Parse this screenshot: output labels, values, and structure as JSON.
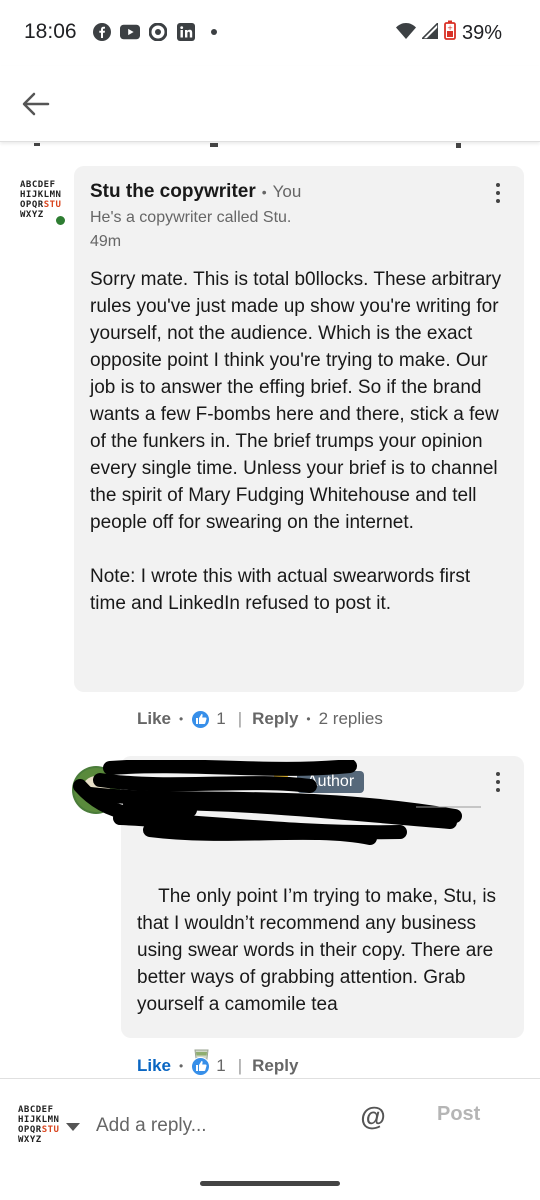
{
  "status_bar": {
    "time": "18:06",
    "left_icons": [
      "facebook-icon",
      "youtube-icon",
      "chrome-icon",
      "linkedin-icon",
      "more-notifications-dot"
    ],
    "battery_percent": "39%"
  },
  "header": {
    "back_icon": "back-arrow-icon"
  },
  "comments": [
    {
      "author": "Stu the copywriter",
      "relation": "You",
      "headline": "He's a copywriter called Stu.",
      "time": "49m",
      "avatar_lines": [
        "ABCDEF",
        "HIJKLMN",
        "OPQRSTU",
        "WXYZ"
      ],
      "text": "Sorry mate. This is total b0llocks. These arbitrary rules you've just made up show you're writing for yourself, not the audience. Which is the exact opposite point I think you're trying to make. Our job is to answer the effing brief. So if the brand wants a few F-bombs here and there, stick a few of the funkers in. The brief trumps your opinion every single time. Unless your brief is to channel the spirit of Mary Fudging Whitehouse and tell people off for swearing on the internet.\n\nNote: I wrote this with actual swearwords first time and LinkedIn refused to post it.",
      "actions": {
        "like": "Like",
        "like_count": "1",
        "reply": "Reply",
        "replies": "2 replies"
      }
    }
  ],
  "reply": {
    "author_badge": "Author",
    "text": "The only point I’m trying to make, Stu, is that I wouldn’t recommend any business using swear words in their copy. There are better ways of grabbing attention. Grab yourself a camomile tea",
    "actions": {
      "like": "Like",
      "like_count": "1",
      "reply": "Reply"
    }
  },
  "reply_bar": {
    "placeholder": "Add a reply...",
    "mention_symbol": "@",
    "post_label": "Post"
  },
  "colors": {
    "accent_blue": "#0a66c2",
    "bubble_bg": "#f2f2f2",
    "author_badge_bg": "#56687a",
    "online_green": "#2e7d32"
  }
}
